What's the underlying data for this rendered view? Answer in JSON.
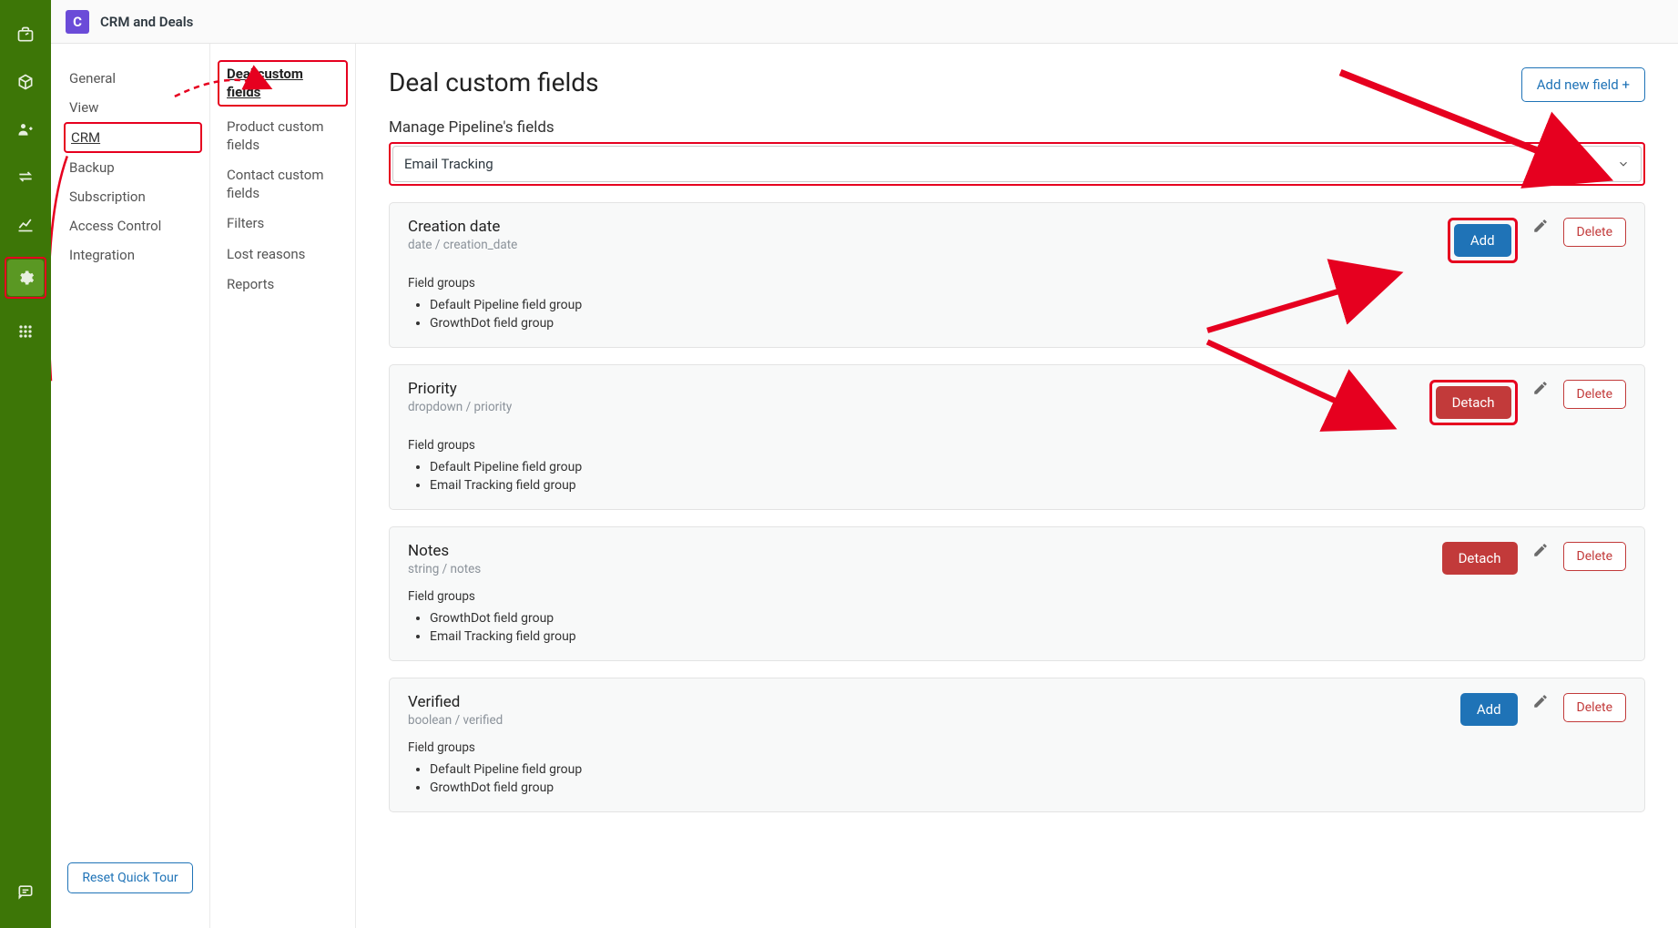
{
  "header": {
    "app_title": "CRM and Deals",
    "logo_letter": "C"
  },
  "nav1": {
    "items": [
      "General",
      "View",
      "CRM",
      "Backup",
      "Subscription",
      "Access Control",
      "Integration"
    ],
    "active_index": 2,
    "reset_label": "Reset Quick Tour"
  },
  "nav2": {
    "items": [
      "Deal custom fields",
      "Product custom fields",
      "Contact custom fields",
      "Filters",
      "Lost reasons",
      "Reports"
    ],
    "active_index": 0
  },
  "main": {
    "title": "Deal custom fields",
    "add_field_label": "Add new field +",
    "manage_label": "Manage Pipeline's fields",
    "pipeline_selected": "Email Tracking",
    "field_groups_label": "Field groups",
    "button_add": "Add",
    "button_detach": "Detach",
    "button_delete": "Delete",
    "cards": [
      {
        "name": "Creation date",
        "meta": "date / creation_date",
        "action": "add",
        "highlighted": true,
        "groups": [
          "Default Pipeline field group",
          "GrowthDot field group"
        ]
      },
      {
        "name": "Priority",
        "meta": "dropdown / priority",
        "action": "detach",
        "highlighted": true,
        "groups": [
          "Default Pipeline field group",
          "Email Tracking field group"
        ]
      },
      {
        "name": "Notes",
        "meta": "string / notes",
        "action": "detach",
        "highlighted": false,
        "groups": [
          "GrowthDot field group",
          "Email Tracking field group"
        ]
      },
      {
        "name": "Verified",
        "meta": "boolean / verified",
        "action": "add",
        "highlighted": false,
        "groups": [
          "Default Pipeline field group",
          "GrowthDot field group"
        ]
      }
    ]
  }
}
